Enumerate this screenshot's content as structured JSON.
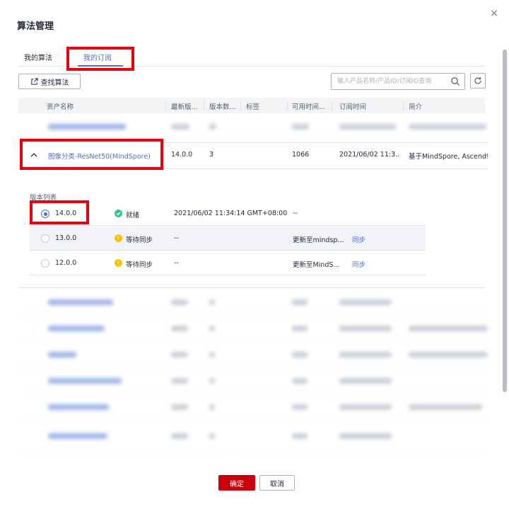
{
  "dialog": {
    "title": "算法管理",
    "close_glyph": "×"
  },
  "tabs": [
    {
      "label": "我的算法"
    },
    {
      "label": "我的订阅"
    }
  ],
  "toolbar": {
    "find_label": "查找算法",
    "search_placeholder": "输入产品名称/产品ID/订阅ID查询"
  },
  "table": {
    "columns": [
      "资产名称",
      "最新版...",
      "版本数...",
      "标签",
      "可用时间...",
      "订阅时间",
      "简介"
    ],
    "expanded_row": {
      "name": "图像分类-ResNet50(MindSpore)",
      "latest_version": "14.0.0",
      "version_count": "3",
      "tags": "",
      "available_time": "1066",
      "subscribe_time": "2021/06/02 11:3...",
      "description": "基于MindSpore, Ascend9"
    }
  },
  "versions": {
    "label": "版本列表",
    "rows": [
      {
        "version": "14.0.0",
        "selected": true,
        "status": "就绪",
        "status_color": "#3ec28f",
        "time": "2021/06/02 11:34:14 GMT+08:00",
        "note": "--",
        "action": ""
      },
      {
        "version": "13.0.0",
        "selected": false,
        "status": "等待同步",
        "status_color": "#fac20a",
        "time": "--",
        "note": "更新至mindsp...",
        "action": "同步"
      },
      {
        "version": "12.0.0",
        "selected": false,
        "status": "等待同步",
        "status_color": "#fac20a",
        "time": "--",
        "note": "更新至MindS...",
        "action": "同步"
      }
    ]
  },
  "footer": {
    "ok_label": "确定",
    "cancel_label": "取消"
  },
  "colors": {
    "accent": "#526ecc",
    "primary_button": "#c7000b",
    "highlight_box": "#e8000f"
  }
}
